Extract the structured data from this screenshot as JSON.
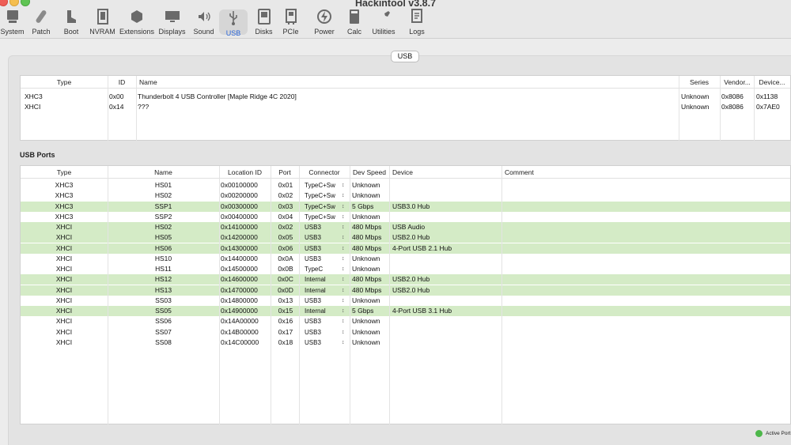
{
  "window": {
    "title": "Hackintool v3.8.7"
  },
  "toolbar": {
    "items": [
      {
        "label": "System",
        "icon": "system-icon"
      },
      {
        "label": "Patch",
        "icon": "patch-icon"
      },
      {
        "label": "Boot",
        "icon": "boot-icon"
      },
      {
        "label": "NVRAM",
        "icon": "nvram-icon"
      },
      {
        "label": "Extensions",
        "icon": "extensions-icon"
      },
      {
        "label": "Displays",
        "icon": "displays-icon"
      },
      {
        "label": "Sound",
        "icon": "sound-icon"
      },
      {
        "label": "USB",
        "icon": "usb-icon"
      },
      {
        "label": "Disks",
        "icon": "disks-icon"
      },
      {
        "label": "PCIe",
        "icon": "pcie-icon"
      },
      {
        "label": "Power",
        "icon": "power-icon"
      },
      {
        "label": "Calc",
        "icon": "calc-icon"
      },
      {
        "label": "Utilities",
        "icon": "utilities-icon"
      },
      {
        "label": "Logs",
        "icon": "logs-icon"
      }
    ],
    "active": "USB"
  },
  "tab": {
    "label": "USB"
  },
  "controllers": {
    "headers": {
      "type": "Type",
      "id": "ID",
      "name": "Name",
      "series": "Series",
      "vendor": "Vendor...",
      "device": "Device..."
    },
    "rows": [
      {
        "type": "XHC3",
        "id": "0x00",
        "name": "Thunderbolt 4 USB Controller [Maple Ridge 4C 2020]",
        "series": "Unknown",
        "vendor": "0x8086",
        "device": "0x1138"
      },
      {
        "type": "XHCI",
        "id": "0x14",
        "name": "???",
        "series": "Unknown",
        "vendor": "0x8086",
        "device": "0x7AE0"
      }
    ]
  },
  "ports": {
    "title": "USB Ports",
    "headers": {
      "type": "Type",
      "name": "Name",
      "location": "Location ID",
      "port": "Port",
      "connector": "Connector",
      "speed": "Dev Speed",
      "device": "Device",
      "comment": "Comment"
    },
    "rows": [
      {
        "type": "XHC3",
        "name": "HS01",
        "location": "0x00100000",
        "port": "0x01",
        "connector": "TypeC+Sw",
        "speed": "Unknown",
        "device": "",
        "active": false
      },
      {
        "type": "XHC3",
        "name": "HS02",
        "location": "0x00200000",
        "port": "0x02",
        "connector": "TypeC+Sw",
        "speed": "Unknown",
        "device": "",
        "active": false
      },
      {
        "type": "XHC3",
        "name": "SSP1",
        "location": "0x00300000",
        "port": "0x03",
        "connector": "TypeC+Sw",
        "speed": "5 Gbps",
        "device": "USB3.0 Hub",
        "active": true
      },
      {
        "type": "XHC3",
        "name": "SSP2",
        "location": "0x00400000",
        "port": "0x04",
        "connector": "TypeC+Sw",
        "speed": "Unknown",
        "device": "",
        "active": false
      },
      {
        "type": "XHCI",
        "name": "HS02",
        "location": "0x14100000",
        "port": "0x02",
        "connector": "USB3",
        "speed": "480 Mbps",
        "device": "USB Audio",
        "active": true
      },
      {
        "type": "XHCI",
        "name": "HS05",
        "location": "0x14200000",
        "port": "0x05",
        "connector": "USB3",
        "speed": "480 Mbps",
        "device": "USB2.0 Hub",
        "active": true
      },
      {
        "type": "XHCI",
        "name": "HS06",
        "location": "0x14300000",
        "port": "0x06",
        "connector": "USB3",
        "speed": "480 Mbps",
        "device": "4-Port USB 2.1 Hub",
        "active": true
      },
      {
        "type": "XHCI",
        "name": "HS10",
        "location": "0x14400000",
        "port": "0x0A",
        "connector": "USB3",
        "speed": "Unknown",
        "device": "",
        "active": false
      },
      {
        "type": "XHCI",
        "name": "HS11",
        "location": "0x14500000",
        "port": "0x0B",
        "connector": "TypeC",
        "speed": "Unknown",
        "device": "",
        "active": false
      },
      {
        "type": "XHCI",
        "name": "HS12",
        "location": "0x14600000",
        "port": "0x0C",
        "connector": "Internal",
        "speed": "480 Mbps",
        "device": "USB2.0 Hub",
        "active": true
      },
      {
        "type": "XHCI",
        "name": "HS13",
        "location": "0x14700000",
        "port": "0x0D",
        "connector": "Internal",
        "speed": "480 Mbps",
        "device": "USB2.0 Hub",
        "active": true
      },
      {
        "type": "XHCI",
        "name": "SS03",
        "location": "0x14800000",
        "port": "0x13",
        "connector": "USB3",
        "speed": "Unknown",
        "device": "",
        "active": false
      },
      {
        "type": "XHCI",
        "name": "SS05",
        "location": "0x14900000",
        "port": "0x15",
        "connector": "Internal",
        "speed": "5 Gbps",
        "device": "4-Port USB 3.1 Hub",
        "active": true
      },
      {
        "type": "XHCI",
        "name": "SS06",
        "location": "0x14A00000",
        "port": "0x16",
        "connector": "USB3",
        "speed": "Unknown",
        "device": "",
        "active": false
      },
      {
        "type": "XHCI",
        "name": "SS07",
        "location": "0x14B00000",
        "port": "0x17",
        "connector": "USB3",
        "speed": "Unknown",
        "device": "",
        "active": false
      },
      {
        "type": "XHCI",
        "name": "SS08",
        "location": "0x14C00000",
        "port": "0x18",
        "connector": "USB3",
        "speed": "Unknown",
        "device": "",
        "active": false
      }
    ]
  },
  "legend": {
    "active_label": "Active Port",
    "active_color": "#4db74a"
  },
  "colors": {
    "active_row": "#d4ebc6",
    "accent": "#2a66d9"
  }
}
